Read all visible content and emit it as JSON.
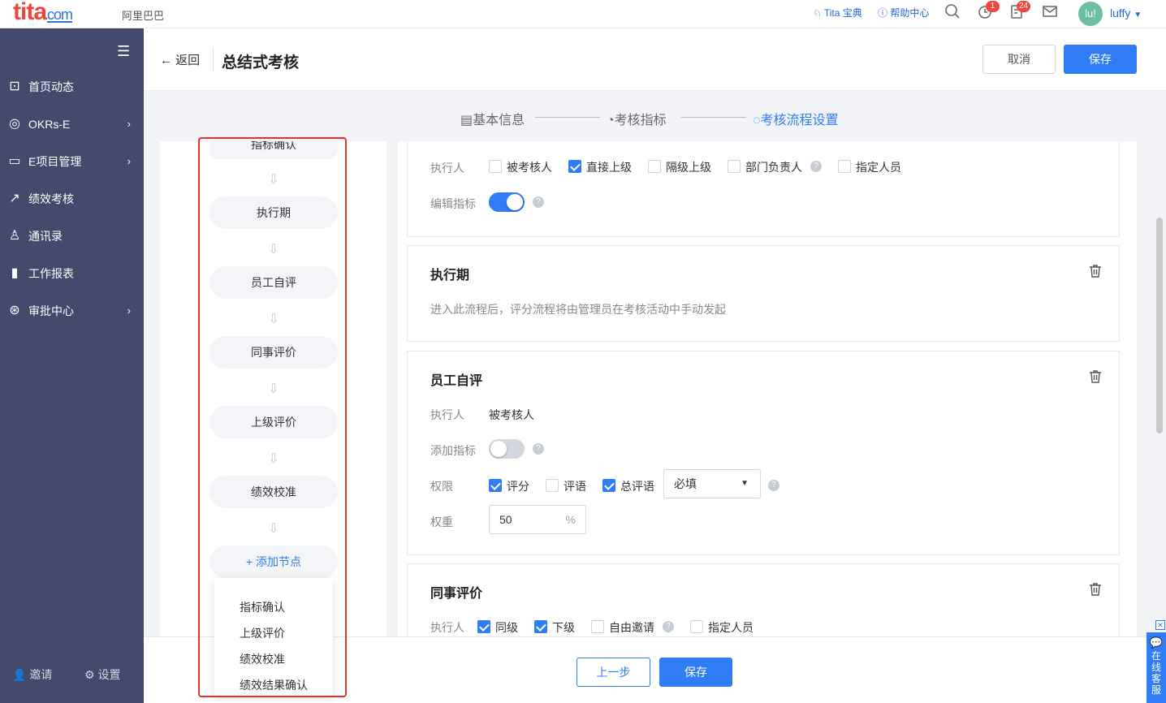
{
  "topbar": {
    "logo": "tita",
    "logo_suffix": "com",
    "company": "阿里巴巴",
    "tita_link": "Tita 宝典",
    "help_link": "帮助中心",
    "reminder_badge": "1",
    "task_badge": "24",
    "avatar_text": "lu!",
    "username": "luffy"
  },
  "sidebar": {
    "items": [
      {
        "label": "首页动态",
        "icon": "message-icon"
      },
      {
        "label": "OKRs-E",
        "icon": "target-icon",
        "chevron": true
      },
      {
        "label": "E项目管理",
        "icon": "monitor-icon",
        "chevron": true
      },
      {
        "label": "绩效考核",
        "icon": "edit-icon"
      },
      {
        "label": "通讯录",
        "icon": "user-icon"
      },
      {
        "label": "工作报表",
        "icon": "bar-chart-icon"
      },
      {
        "label": "审批中心",
        "icon": "approval-icon",
        "chevron": true
      }
    ],
    "invite": "邀请",
    "settings": "设置"
  },
  "header": {
    "back": "返回",
    "title": "总结式考核",
    "cancel": "取消",
    "save": "保存"
  },
  "steps": [
    "基本信息",
    "考核指标",
    "考核流程设置"
  ],
  "flow": {
    "nodes": [
      "指标确认",
      "执行期",
      "员工自评",
      "同事评价",
      "上级评价",
      "绩效校准"
    ],
    "add_node": "+ 添加节点",
    "dropdown": [
      "指标确认",
      "上级评价",
      "绩效校准",
      "绩效结果确认"
    ]
  },
  "card0": {
    "executor_label": "执行人",
    "options": [
      {
        "label": "被考核人",
        "checked": false
      },
      {
        "label": "直接上级",
        "checked": true
      },
      {
        "label": "隔级上级",
        "checked": false
      },
      {
        "label": "部门负责人",
        "checked": false
      },
      {
        "label": "指定人员",
        "checked": false
      }
    ],
    "edit_label": "编辑指标",
    "edit_on": true
  },
  "card1": {
    "title": "执行期",
    "desc": "进入此流程后，评分流程将由管理员在考核活动中手动发起"
  },
  "card2": {
    "title": "员工自评",
    "executor_label": "执行人",
    "executor_value": "被考核人",
    "add_label": "添加指标",
    "add_on": false,
    "perm_label": "权限",
    "perms": [
      {
        "label": "评分",
        "checked": true
      },
      {
        "label": "评语",
        "checked": false
      },
      {
        "label": "总评语",
        "checked": true
      }
    ],
    "select_value": "必填",
    "weight_label": "权重",
    "weight_value": "50",
    "weight_unit": "%"
  },
  "card3": {
    "title": "同事评价",
    "executor_label": "执行人",
    "options": [
      {
        "label": "同级",
        "checked": true
      },
      {
        "label": "下级",
        "checked": true
      },
      {
        "label": "自由邀请",
        "checked": false
      },
      {
        "label": "指定人员",
        "checked": false
      }
    ]
  },
  "footer": {
    "prev": "上一步",
    "save": "保存"
  },
  "service": "在线客服",
  "colors": {
    "primary": "#2f7cf6",
    "sidebar": "#434a6c",
    "highlight": "#e5332a"
  }
}
